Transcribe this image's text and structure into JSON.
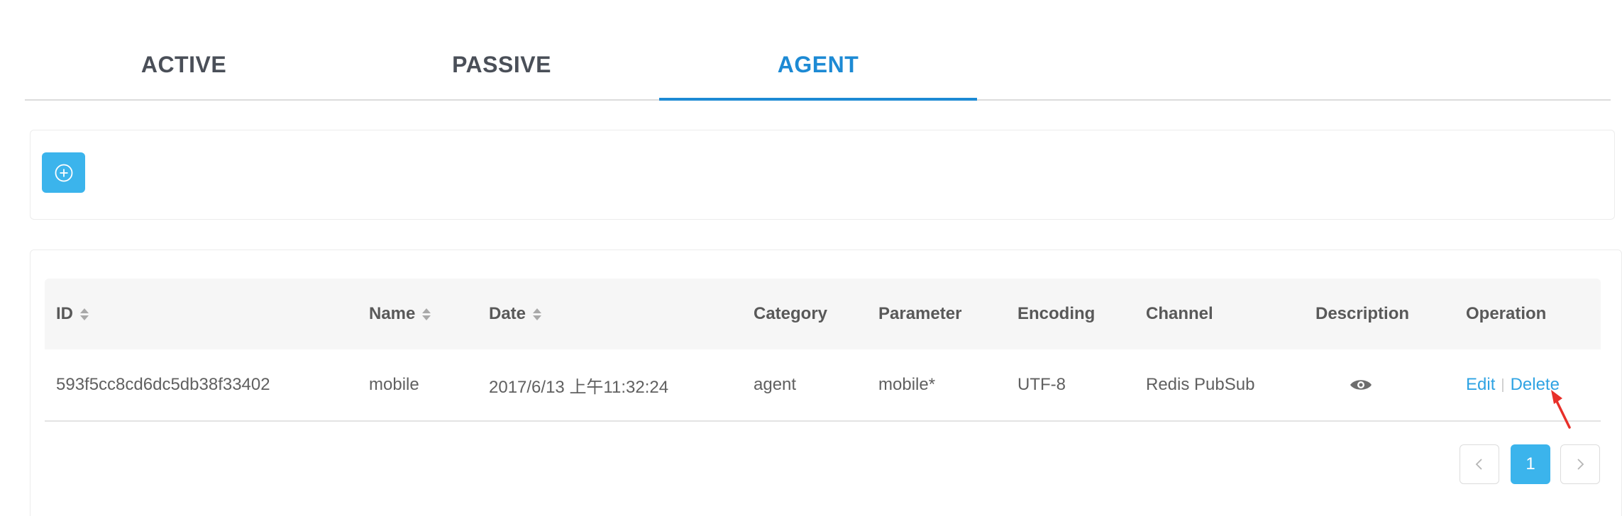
{
  "tabs": [
    {
      "label": "ACTIVE"
    },
    {
      "label": "PASSIVE"
    },
    {
      "label": "AGENT",
      "active": true
    }
  ],
  "toolbar": {
    "add_icon": "plus-circle-icon"
  },
  "table": {
    "columns": {
      "id": "ID",
      "name": "Name",
      "date": "Date",
      "category": "Category",
      "parameter": "Parameter",
      "encoding": "Encoding",
      "channel": "Channel",
      "description": "Description",
      "operation": "Operation"
    },
    "rows": [
      {
        "id": "593f5cc8cd6dc5db38f33402",
        "name": "mobile",
        "date": "2017/6/13 上午11:32:24",
        "category": "agent",
        "parameter": "mobile*",
        "encoding": "UTF-8",
        "channel": "Redis PubSub",
        "description_icon": "eye-icon",
        "edit": "Edit",
        "separator": "|",
        "delete": "Delete"
      }
    ]
  },
  "pagination": {
    "current": "1"
  },
  "colors": {
    "accent": "#1d8ad4",
    "button": "#3bb4ec",
    "link": "#2fa3e3",
    "annotation": "#e8302a"
  }
}
